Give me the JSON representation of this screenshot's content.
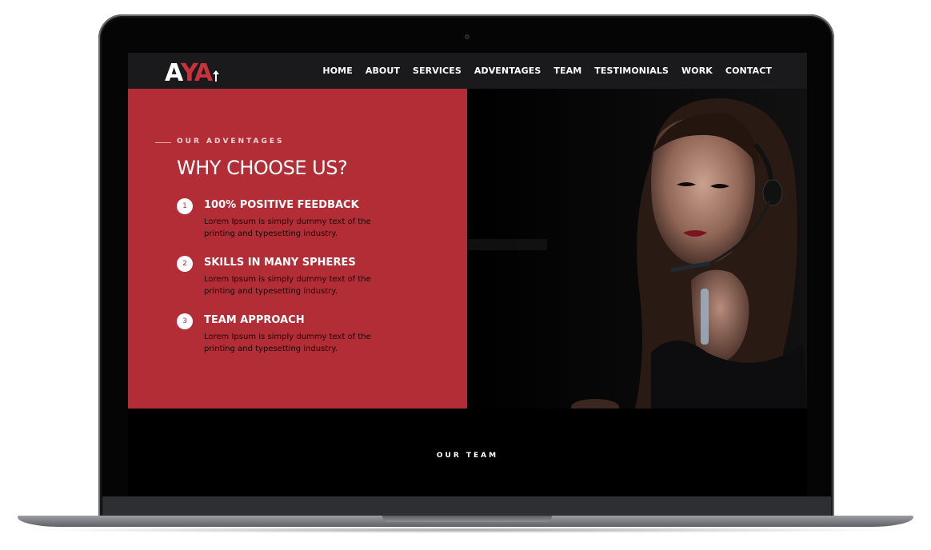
{
  "brand": {
    "logo_first": "A",
    "logo_rest": "YA",
    "accent_color": "#b22d35"
  },
  "nav": {
    "items": [
      {
        "label": "HOME"
      },
      {
        "label": "ABOUT"
      },
      {
        "label": "SERVICES"
      },
      {
        "label": "ADVENTAGES"
      },
      {
        "label": "TEAM"
      },
      {
        "label": "TESTIMONIALS"
      },
      {
        "label": "WORK"
      },
      {
        "label": "CONTACT"
      }
    ]
  },
  "advantages": {
    "eyebrow": "OUR ADVENTAGES",
    "heading": "WHY CHOOSE US?",
    "features": [
      {
        "number": "1",
        "title": "100% POSITIVE FEEDBACK",
        "description": "Lorem Ipsum is simply dummy text of the printing and typesetting industry."
      },
      {
        "number": "2",
        "title": "SKILLS IN MANY SPHERES",
        "description": "Lorem Ipsum is simply dummy text of the printing and typesetting industry."
      },
      {
        "number": "3",
        "title": "TEAM APPROACH",
        "description": "Lorem Ipsum is simply dummy text of the printing and typesetting industry."
      }
    ]
  },
  "team": {
    "label": "OUR TEAM"
  },
  "icons": {
    "logo_arrow": "arrow-up-icon",
    "camera": "camera-icon",
    "photo": "support-agent-photo"
  }
}
